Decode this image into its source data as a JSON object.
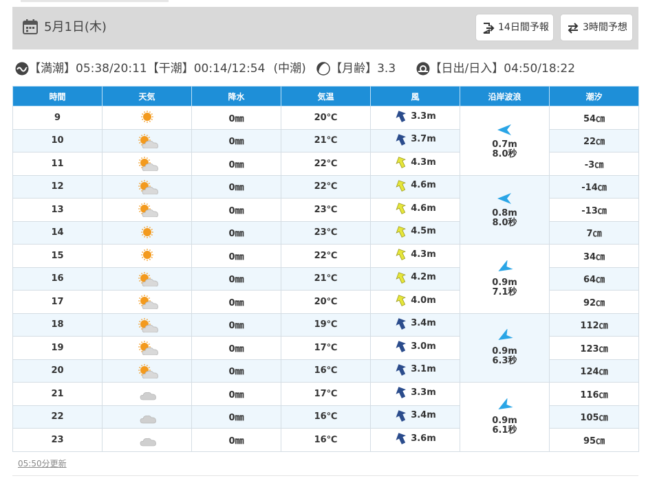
{
  "header": {
    "date": "5月1日(木)",
    "buttons": [
      {
        "label": "14日間予報",
        "icon": "exit-arrow-icon"
      },
      {
        "label": "3時間予想",
        "icon": "swap-arrows-icon"
      }
    ]
  },
  "tide_info": {
    "high_label": "【満潮】",
    "high_value": "05:38/20:11",
    "low_label": "【干潮】",
    "low_value": "00:14/12:54",
    "tide_type": "(中潮)",
    "moon_label": "【月齢】",
    "moon_value": "3.3",
    "sun_label": "【日出/日入】",
    "sun_value": "04:50/18:22"
  },
  "columns": [
    "時間",
    "天気",
    "降水",
    "気温",
    "風",
    "沿岸波浪",
    "潮汐"
  ],
  "rows": [
    {
      "hour": "9",
      "weather": "sunny",
      "precip": "0㎜",
      "temp": "20℃",
      "wind_speed": "3.3m",
      "wind_color": "navy",
      "tide": "54㎝"
    },
    {
      "hour": "10",
      "weather": "sunny-cloudy",
      "precip": "0㎜",
      "temp": "21℃",
      "wind_speed": "3.7m",
      "wind_color": "navy",
      "tide": "22㎝"
    },
    {
      "hour": "11",
      "weather": "sunny-cloudy",
      "precip": "0㎜",
      "temp": "22℃",
      "wind_speed": "4.3m",
      "wind_color": "yellow",
      "tide": "-3㎝"
    },
    {
      "hour": "12",
      "weather": "sunny-cloudy",
      "precip": "0㎜",
      "temp": "22℃",
      "wind_speed": "4.6m",
      "wind_color": "yellow",
      "tide": "-14㎝"
    },
    {
      "hour": "13",
      "weather": "sunny-cloudy",
      "precip": "0㎜",
      "temp": "23℃",
      "wind_speed": "4.6m",
      "wind_color": "yellow",
      "tide": "-13㎝"
    },
    {
      "hour": "14",
      "weather": "sunny",
      "precip": "0㎜",
      "temp": "23℃",
      "wind_speed": "4.5m",
      "wind_color": "yellow",
      "tide": "7㎝"
    },
    {
      "hour": "15",
      "weather": "sunny",
      "precip": "0㎜",
      "temp": "22℃",
      "wind_speed": "4.3m",
      "wind_color": "yellow",
      "tide": "34㎝"
    },
    {
      "hour": "16",
      "weather": "sunny-cloudy",
      "precip": "0㎜",
      "temp": "21℃",
      "wind_speed": "4.2m",
      "wind_color": "yellow",
      "tide": "64㎝"
    },
    {
      "hour": "17",
      "weather": "sunny-cloudy",
      "precip": "0㎜",
      "temp": "20℃",
      "wind_speed": "4.0m",
      "wind_color": "yellow",
      "tide": "92㎝"
    },
    {
      "hour": "18",
      "weather": "sunny-cloudy",
      "precip": "0㎜",
      "temp": "19℃",
      "wind_speed": "3.4m",
      "wind_color": "navy",
      "tide": "112㎝"
    },
    {
      "hour": "19",
      "weather": "sunny-cloudy",
      "precip": "0㎜",
      "temp": "17℃",
      "wind_speed": "3.0m",
      "wind_color": "navy",
      "tide": "123㎝"
    },
    {
      "hour": "20",
      "weather": "sunny-cloudy",
      "precip": "0㎜",
      "temp": "16℃",
      "wind_speed": "3.1m",
      "wind_color": "navy",
      "tide": "124㎝"
    },
    {
      "hour": "21",
      "weather": "cloudy",
      "precip": "0㎜",
      "temp": "17℃",
      "wind_speed": "3.3m",
      "wind_color": "navy",
      "tide": "116㎝"
    },
    {
      "hour": "22",
      "weather": "cloudy",
      "precip": "0㎜",
      "temp": "16℃",
      "wind_speed": "3.4m",
      "wind_color": "navy",
      "tide": "105㎝"
    },
    {
      "hour": "23",
      "weather": "cloudy",
      "precip": "0㎜",
      "temp": "16℃",
      "wind_speed": "3.6m",
      "wind_color": "navy",
      "tide": "95㎝"
    }
  ],
  "waves": [
    {
      "height": "0.7m",
      "period": "8.0秒",
      "direction": "left"
    },
    {
      "height": "0.8m",
      "period": "8.0秒",
      "direction": "left"
    },
    {
      "height": "0.9m",
      "period": "7.1秒",
      "direction": "down-left"
    },
    {
      "height": "0.9m",
      "period": "6.3秒",
      "direction": "down-left"
    },
    {
      "height": "0.9m",
      "period": "6.1秒",
      "direction": "down-left"
    }
  ],
  "colors": {
    "header_blue": "#1e8fd8",
    "wind_navy": "#2b4c8c",
    "wind_yellow": "#e6e63a",
    "wave_arrow": "#2aa5e6",
    "sun_orange": "#f39a1e"
  },
  "footer": {
    "updated": "05:50分更新"
  }
}
